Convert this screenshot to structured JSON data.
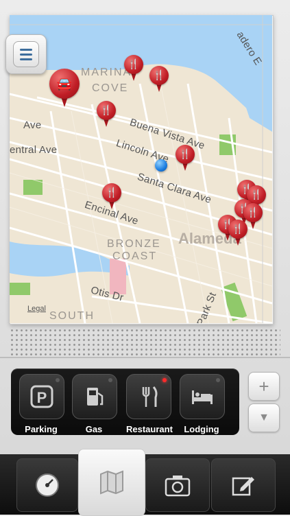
{
  "map": {
    "streets": [
      "Buena Vista Ave",
      "Lincoln Ave",
      "Santa Clara Ave",
      "Encinal Ave",
      "entral Ave",
      "Ave",
      "Otis Dr",
      "Park St",
      "adero E"
    ],
    "areas": [
      "MARINA",
      "COVE",
      "BRONZE",
      "COAST",
      "SOUTH"
    ],
    "city": "Alameda",
    "legal": "Legal"
  },
  "menu_button": {
    "icon": "hamburger-menu-icon"
  },
  "categories": [
    {
      "label": "Parking",
      "icon": "parking-icon",
      "active": false
    },
    {
      "label": "Gas",
      "icon": "gas-pump-icon",
      "active": false
    },
    {
      "label": "Restaurant",
      "icon": "fork-knife-icon",
      "active": true
    },
    {
      "label": "Lodging",
      "icon": "bed-icon",
      "active": false
    }
  ],
  "zoom": {
    "in_label": "+",
    "out_label": "▼"
  },
  "tabs": [
    {
      "icon": "speedometer-icon",
      "active": false
    },
    {
      "icon": "map-icon",
      "active": true
    },
    {
      "icon": "camera-icon",
      "active": false
    },
    {
      "icon": "edit-icon",
      "active": false
    }
  ],
  "colors": {
    "pin": "#c01e26",
    "location": "#1b7de0",
    "water": "#a9d3f5",
    "park": "#90c96a"
  }
}
